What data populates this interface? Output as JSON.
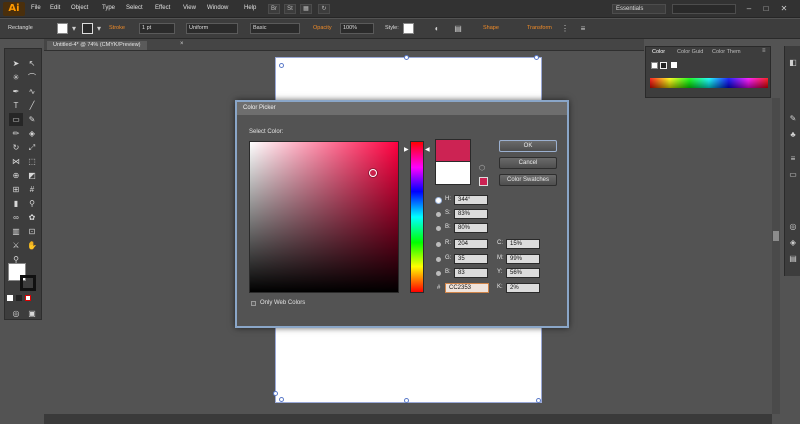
{
  "app": {
    "logo": "Ai"
  },
  "menu": [
    "File",
    "Edit",
    "Object",
    "Type",
    "Select",
    "Effect",
    "View",
    "Window",
    "Help"
  ],
  "workspace": "Essentials",
  "control_bar": {
    "tool_name": "Rectangle",
    "stroke_label": "Stroke",
    "stroke_value": "1 pt",
    "profile_value": "Uniform",
    "brush_value": "Basic",
    "opacity_label": "Opacity",
    "opacity_value": "100%",
    "style_label": "Style:",
    "shape_label": "Shape",
    "transform_label": "Transform"
  },
  "document_tab": {
    "label": "Untitled-4* @ 74% (CMYK/Preview)",
    "close": "×"
  },
  "panel": {
    "tabs": [
      "Color",
      "Color Guid",
      "Color Them"
    ]
  },
  "dialog": {
    "title": "Color Picker",
    "select_label": "Select Color:",
    "hue_color": "#ff0040",
    "new_color": "#cc2353",
    "old_color": "#ffffff",
    "buttons": {
      "ok": "OK",
      "cancel": "Cancel",
      "swatches": "Color Swatches"
    },
    "fields": {
      "H": "344°",
      "S": "83%",
      "B": "80%",
      "R": "204",
      "G": "35",
      "B2": "83",
      "C": "15%",
      "M": "99%",
      "Y": "56%",
      "K": "2%",
      "hex": "CC2353"
    },
    "labels": {
      "H": "H:",
      "S": "S:",
      "B": "B:",
      "R": "R:",
      "G": "G:",
      "B2": "B:",
      "C": "C:",
      "M": "M:",
      "Y": "Y:",
      "K": "K:",
      "hash": "#"
    },
    "web_only_label": "Only Web Colors"
  },
  "colors": {
    "accent_orange": "#f08b28",
    "selection_blue": "#5b7ac9"
  }
}
